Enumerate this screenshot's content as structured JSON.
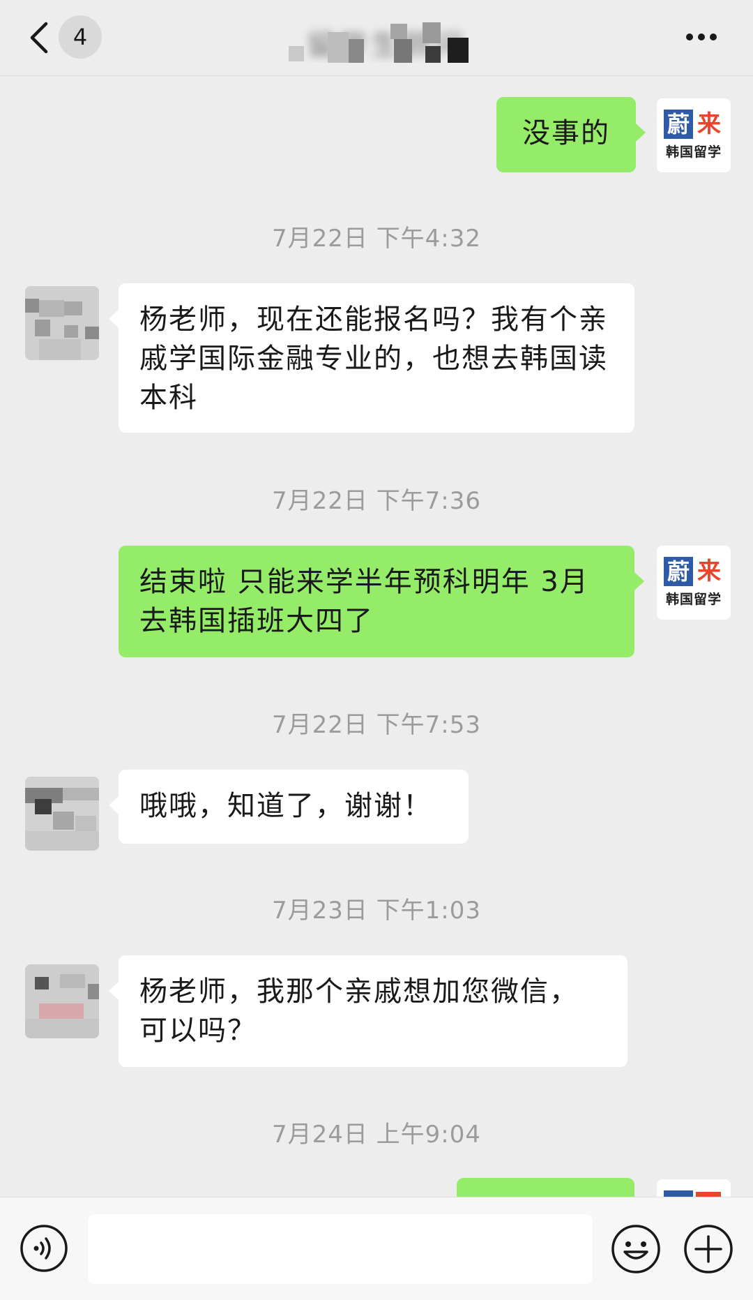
{
  "header": {
    "unread_count": "4",
    "title": "留学生顾问"
  },
  "messages": [
    {
      "type": "message",
      "side": "right",
      "text": "没事的",
      "avatar": "brand"
    },
    {
      "type": "time",
      "text": "7月22日 下午4:32"
    },
    {
      "type": "message",
      "side": "left",
      "text": "杨老师，现在还能报名吗？我有个亲戚学国际金融专业的，也想去韩国读本科",
      "avatar": "contact"
    },
    {
      "type": "time",
      "text": "7月22日 下午7:36"
    },
    {
      "type": "message",
      "side": "right",
      "text": "结束啦 只能来学半年预科明年 3月去韩国插班大四了",
      "avatar": "brand"
    },
    {
      "type": "time",
      "text": "7月22日 下午7:53"
    },
    {
      "type": "message",
      "side": "left",
      "text": "哦哦，知道了，谢谢！",
      "avatar": "contact"
    },
    {
      "type": "time",
      "text": "7月23日 下午1:03"
    },
    {
      "type": "message",
      "side": "left",
      "text": "杨老师，我那个亲戚想加您微信，可以吗？",
      "avatar": "contact"
    },
    {
      "type": "time",
      "text": "7月24日 上午9:04"
    }
  ],
  "brand_avatar": {
    "char_1": "蔚",
    "char_2": "来",
    "subtitle": "韩国留学"
  },
  "input_bar": {
    "value": "",
    "placeholder": ""
  },
  "colors": {
    "background": "#ededed",
    "sent_bubble": "#95ec69",
    "received_bubble": "#ffffff",
    "timestamp_text": "#9b9b9b",
    "brand_blue": "#2e5aa8",
    "brand_red": "#e8452c"
  },
  "icons": {
    "back": "chevron-left-icon",
    "more": "more-dots-icon",
    "voice": "voice-icon",
    "emoji": "emoji-icon",
    "plus": "plus-icon"
  }
}
